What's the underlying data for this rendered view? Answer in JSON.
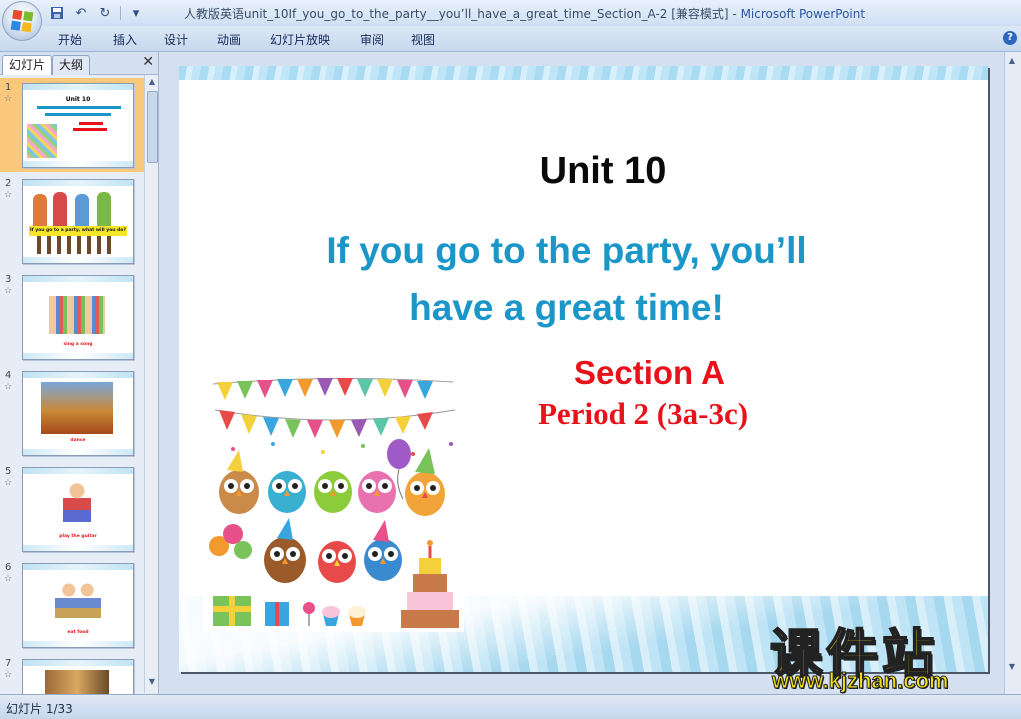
{
  "window": {
    "title": "人教版英语unit_10If_you_go_to_the_party__you’ll_have_a_great_time_Section_A-2 [兼容模式]",
    "app": "Microsoft PowerPoint"
  },
  "ribbon": {
    "tabs": [
      "开始",
      "插入",
      "设计",
      "动画",
      "幻灯片放映",
      "审阅",
      "视图"
    ]
  },
  "panel": {
    "tab_slides": "幻灯片",
    "tab_outline": "大纲",
    "close": "✕"
  },
  "thumbnails": [
    {
      "num": "1",
      "caption": "Unit 10"
    },
    {
      "num": "2",
      "caption": "If you go to a party, what will you do?"
    },
    {
      "num": "3",
      "caption": "sing a song"
    },
    {
      "num": "4",
      "caption": "dance"
    },
    {
      "num": "5",
      "caption": "play the guitar"
    },
    {
      "num": "6",
      "caption": "eat food"
    },
    {
      "num": "7",
      "caption": ""
    }
  ],
  "slide": {
    "unit": "Unit 10",
    "title_line1": "If you go to the party, you’ll",
    "title_line2": "have a great time!",
    "section": "Section A",
    "period": "Period 2 (3a-3c)"
  },
  "status": {
    "slide_counter": "幻灯片 1/33"
  },
  "watermark": {
    "chinese": "课件站",
    "url": "www.kjzhan.com"
  },
  "colors": {
    "title_blue": "#1b96c9",
    "section_red": "#e8121b",
    "thumb_selected": "#f9c87a",
    "watermark_yellow": "#f4df10"
  }
}
